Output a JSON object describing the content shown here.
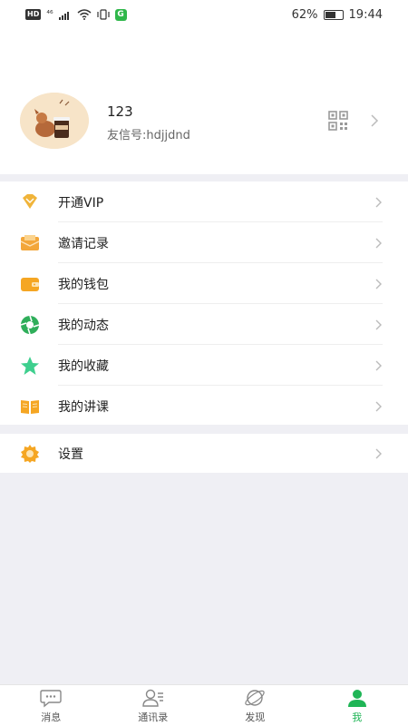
{
  "status_bar": {
    "left_badge": "HD",
    "network": "⁴⁶",
    "app_badge": "G",
    "battery": "62%",
    "battery_level": 0.62,
    "time": "19:44"
  },
  "profile": {
    "name": "123",
    "id_label": "友信号:hdjjdnd"
  },
  "menu_group_1": [
    {
      "label": "开通VIP",
      "icon": "vip-diamond-icon"
    },
    {
      "label": "邀请记录",
      "icon": "envelope-icon"
    },
    {
      "label": "我的钱包",
      "icon": "wallet-icon"
    },
    {
      "label": "我的动态",
      "icon": "aperture-icon"
    },
    {
      "label": "我的收藏",
      "icon": "star-icon"
    },
    {
      "label": "我的讲课",
      "icon": "book-icon"
    }
  ],
  "menu_group_2": [
    {
      "label": "设置",
      "icon": "gear-icon"
    }
  ],
  "tabs": [
    {
      "label": "消息",
      "icon": "chat-bubble-icon",
      "active": false
    },
    {
      "label": "通讯录",
      "icon": "contacts-icon",
      "active": false
    },
    {
      "label": "发现",
      "icon": "planet-icon",
      "active": false
    },
    {
      "label": "我",
      "icon": "person-icon",
      "active": true
    }
  ],
  "colors": {
    "accent_green": "#1fb556",
    "vip_gold": "#f0b43a",
    "background": "#efeff4"
  }
}
